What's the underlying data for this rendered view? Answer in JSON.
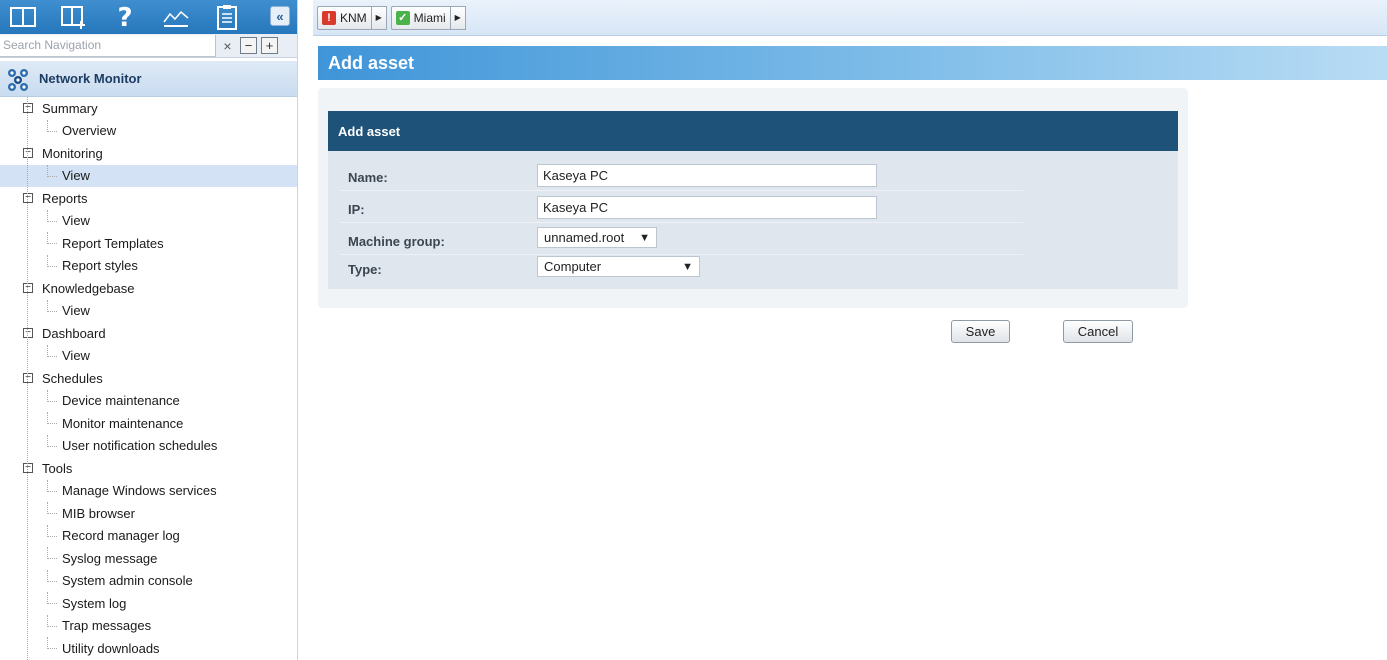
{
  "toolbar": {
    "icons": [
      "book-icon",
      "add-book-icon",
      "help-icon",
      "chart-icon",
      "clipboard-icon"
    ],
    "collapse_glyph": "«"
  },
  "search": {
    "placeholder": "Search Navigation",
    "value": "",
    "clear_glyph": "×",
    "collapse_all_glyph": "−",
    "expand_all_glyph": "+"
  },
  "tree": {
    "title": "Network Monitor",
    "sections": [
      {
        "label": "Summary",
        "children": [
          "Overview"
        ]
      },
      {
        "label": "Monitoring",
        "children": [
          "View"
        ],
        "selected_child": 0
      },
      {
        "label": "Reports",
        "children": [
          "View",
          "Report Templates",
          "Report styles"
        ]
      },
      {
        "label": "Knowledgebase",
        "children": [
          "View"
        ]
      },
      {
        "label": "Dashboard",
        "children": [
          "View"
        ]
      },
      {
        "label": "Schedules",
        "children": [
          "Device maintenance",
          "Monitor maintenance",
          "User notification schedules"
        ]
      },
      {
        "label": "Tools",
        "children": [
          "Manage Windows services",
          "MIB browser",
          "Record manager log",
          "Syslog message",
          "System admin console",
          "System log",
          "Trap messages",
          "Utility downloads"
        ]
      }
    ]
  },
  "breadcrumbs": [
    {
      "label": "KNM",
      "status": "error",
      "status_glyph": "!"
    },
    {
      "label": "Miami",
      "status": "ok",
      "status_glyph": "✓"
    }
  ],
  "page": {
    "title": "Add asset",
    "panel_title": "Add asset"
  },
  "form": {
    "name": {
      "label": "Name:",
      "value": "Kaseya PC"
    },
    "ip": {
      "label": "IP:",
      "value": "Kaseya PC"
    },
    "machine_group": {
      "label": "Machine group:",
      "value": "unnamed.root"
    },
    "type": {
      "label": "Type:",
      "value": "Computer"
    }
  },
  "buttons": {
    "save": "Save",
    "cancel": "Cancel"
  },
  "colors": {
    "toolbar": "#2f82c6",
    "panel_header": "#1f5278",
    "title_bar": "#3f95d8",
    "error": "#d93a2b",
    "ok": "#4bb34b"
  }
}
